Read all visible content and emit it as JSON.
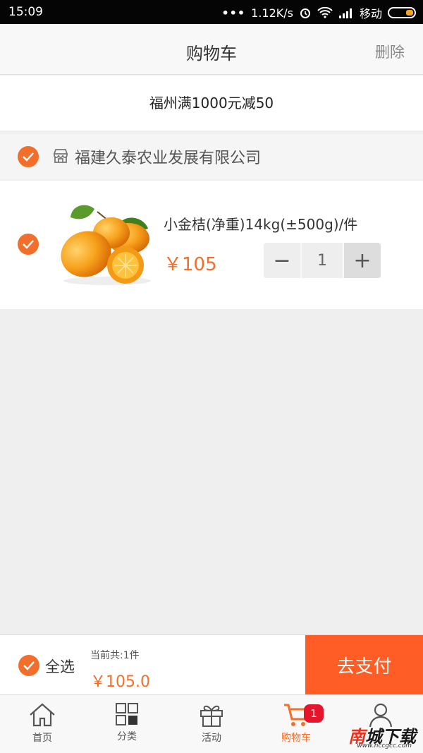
{
  "status": {
    "time": "15:09",
    "speed": "1.12K/s",
    "carrier": "移动"
  },
  "header": {
    "title": "购物车",
    "delete_label": "删除"
  },
  "promo": {
    "text": "福州满1000元减50"
  },
  "store": {
    "name": "福建久泰农业发展有限公司",
    "icon": "shop-icon"
  },
  "items": [
    {
      "name": "小金桔(净重)14kg(±500g)/件",
      "price": "￥105",
      "quantity": "1",
      "minus": "−",
      "plus": "+"
    }
  ],
  "footer": {
    "select_all_label": "全选",
    "count_text": "当前共:1件",
    "total": "￥105.0",
    "pay_label": "去支付"
  },
  "tabs": [
    {
      "label": "首页",
      "icon": "home-icon"
    },
    {
      "label": "分类",
      "icon": "category-icon"
    },
    {
      "label": "活动",
      "icon": "gift-icon"
    },
    {
      "label": "购物车",
      "icon": "cart-icon",
      "badge": "1",
      "active": true
    },
    {
      "label": "",
      "icon": "user-icon"
    }
  ],
  "watermark": {
    "text_black": "城下载",
    "text_red": "南",
    "url": "www.nccgcc.com"
  },
  "colors": {
    "accent": "#f26f2b",
    "pay": "#ff5c26",
    "badge": "#e5162b"
  }
}
